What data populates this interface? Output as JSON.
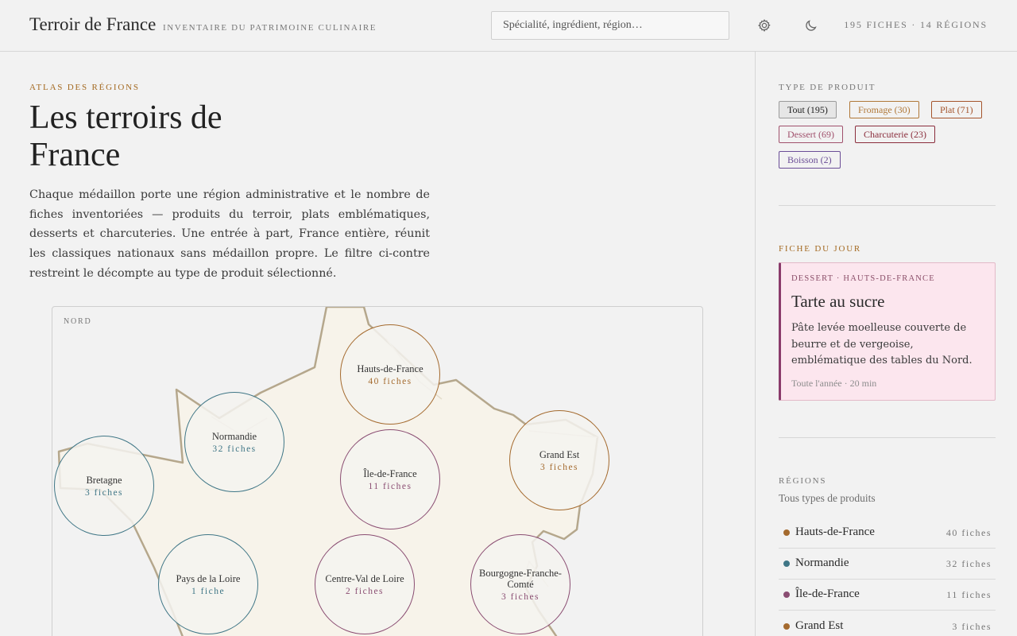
{
  "header": {
    "brand": "Terroir de France",
    "tagline": "Inventaire du patrimoine culinaire",
    "search_placeholder": "Spécialité, ingrédient, région…",
    "counts": "195 fiches · 14 régions",
    "icons": [
      "gear-icon",
      "moon-icon"
    ]
  },
  "main": {
    "kicker": "Atlas des régions",
    "title": "Les terroirs de France",
    "intro": "Chaque médaillon porte une région administrative et le nombre de fiches inventoriées — produits du terroir, plats emblématiques, desserts et charcuteries. Une entrée à part, France entière, réunit les classiques nationaux sans médaillon propre. Le filtre ci-contre restreint le décompte au type de produit sélectionné.",
    "map": {
      "label": "Nord",
      "medallions": [
        {
          "name": "Hauts-de-France",
          "count": "40 fiches",
          "color": "#a46a2e"
        },
        {
          "name": "Normandie",
          "count": "32 fiches",
          "color": "#3f7686"
        },
        {
          "name": "Bretagne",
          "count": "3 fiches",
          "color": "#3f7686"
        },
        {
          "name": "Île-de-France",
          "count": "11 fiches",
          "color": "#8a4d72"
        },
        {
          "name": "Grand Est",
          "count": "3 fiches",
          "color": "#a46a2e"
        },
        {
          "name": "Pays de la Loire",
          "count": "1 fiche",
          "color": "#3f7686"
        },
        {
          "name": "Centre-Val de Loire",
          "count": "2 fiches",
          "color": "#8a4d72"
        },
        {
          "name": "Bourgogne-Franche-Comté",
          "count": "3 fiches",
          "color": "#8a4d72"
        }
      ]
    }
  },
  "sidebar": {
    "filter_heading": "Type de produit",
    "chips": [
      {
        "label": "Tout (195)",
        "color": "#555555",
        "active": true
      },
      {
        "label": "Fromage (30)",
        "color": "#b07838"
      },
      {
        "label": "Plat (71)",
        "color": "#a4542c"
      },
      {
        "label": "Dessert (69)",
        "color": "#a0506c"
      },
      {
        "label": "Charcuterie (23)",
        "color": "#8a2d3c"
      },
      {
        "label": "Boisson (2)",
        "color": "#6a4d96"
      }
    ],
    "fiche_heading": "Fiche du jour",
    "fiche": {
      "meta": "Dessert · Hauts-de-France",
      "title": "Tarte au sucre",
      "desc": "Pâte levée moelleuse couverte de beurre et de vergeoise, emblématique des tables du Nord.",
      "foot": "Toute l'année · 20 min"
    },
    "regions_heading": "Régions",
    "regions_sub": "Tous types de produits",
    "regions": [
      {
        "name": "Hauts-de-France",
        "count": "40 fiches",
        "color": "#a46a2e"
      },
      {
        "name": "Normandie",
        "count": "32 fiches",
        "color": "#3f7686"
      },
      {
        "name": "Île-de-France",
        "count": "11 fiches",
        "color": "#8a4d72"
      },
      {
        "name": "Grand Est",
        "count": "3 fiches",
        "color": "#a46a2e"
      }
    ]
  },
  "colors": {
    "accent": "#a46a22",
    "map_fill": "#f7f3ea",
    "map_stroke": "#b5a78c"
  }
}
